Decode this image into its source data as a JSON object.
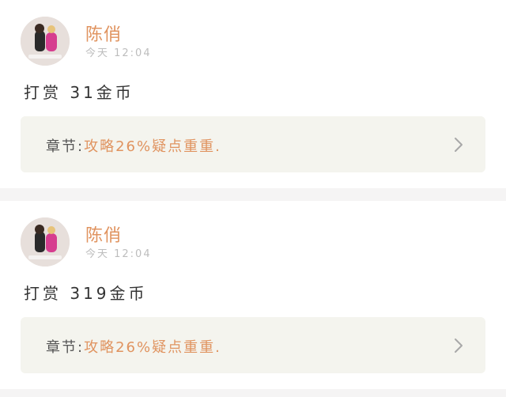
{
  "items": [
    {
      "user_name": "陈俏",
      "time": "今天 12:04",
      "message": "打赏 31金币",
      "chapter_label": "章节:",
      "chapter_title": "攻略26%疑点重重."
    },
    {
      "user_name": "陈俏",
      "time": "今天 12:04",
      "message": "打赏 319金币",
      "chapter_label": "章节:",
      "chapter_title": "攻略26%疑点重重."
    }
  ],
  "icons": {
    "avatar": "avatar-icon",
    "chevron": "chevron-right-icon"
  },
  "colors": {
    "accent": "#e0935f",
    "card_bg": "#f4f4ee",
    "separator": "#f5f4f4"
  }
}
